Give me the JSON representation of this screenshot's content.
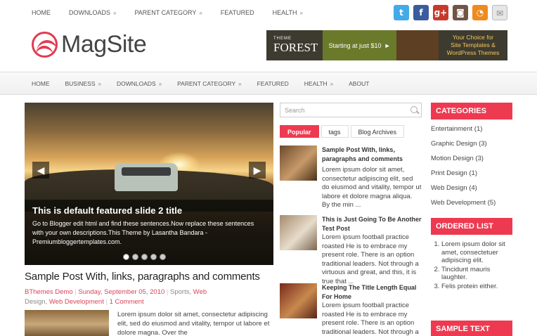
{
  "topnav": {
    "items": [
      {
        "label": "HOME",
        "caret": false
      },
      {
        "label": "DOWNLOADS",
        "caret": true
      },
      {
        "label": "PARENT CATEGORY",
        "caret": true
      },
      {
        "label": "FEATURED",
        "caret": false
      },
      {
        "label": "HEALTH",
        "caret": true
      }
    ],
    "caret_glyph": "»"
  },
  "social": [
    {
      "name": "twitter-icon",
      "glyph": "t",
      "color": "#43a9e7"
    },
    {
      "name": "facebook-icon",
      "glyph": "f",
      "color": "#3a5c9c"
    },
    {
      "name": "google-plus-icon",
      "glyph": "g+",
      "color": "#c8392c"
    },
    {
      "name": "instagram-icon",
      "glyph": "◙",
      "color": "#6f5544"
    },
    {
      "name": "rss-icon",
      "glyph": "◔",
      "color": "#f08a1d"
    },
    {
      "name": "mail-icon",
      "glyph": "✉",
      "color": "#e6e6e6"
    }
  ],
  "logo": {
    "text": "MagSite"
  },
  "banner": {
    "brand_small": "THEME",
    "brand": "FOREST",
    "offer": "Starting at just $10",
    "arrow": "►",
    "tagline_1": "Your Choice for",
    "tagline_2": "Site Templates &",
    "tagline_3": "WordPress Themes"
  },
  "mainnav": {
    "items": [
      {
        "label": "HOME",
        "caret": false
      },
      {
        "label": "BUSINESS",
        "caret": true
      },
      {
        "label": "DOWNLOADS",
        "caret": true
      },
      {
        "label": "PARENT CATEGORY",
        "caret": true
      },
      {
        "label": "FEATURED",
        "caret": false
      },
      {
        "label": "HEALTH",
        "caret": true
      },
      {
        "label": "ABOUT",
        "caret": false
      }
    ]
  },
  "slider": {
    "prev": "◀",
    "next": "▶",
    "title": "This is default featured slide 2 title",
    "text": "Go to Blogger edit html and find these sentences.Now replace these sentences with your own descriptions.This Theme by Lasantha Bandara - Premiumbloggertemplates.com.",
    "dots": 5
  },
  "post": {
    "title": "Sample Post With, links, paragraphs and comments",
    "author": "BThemes Demo",
    "date": "Sunday, September 05, 2010",
    "cat1": "Sports,",
    "cat2": "Web",
    "cat3": "Design,",
    "cat4": "Web Development",
    "comments": "1 Comment",
    "excerpt": "Lorem ipsum dolor sit amet, consectetur adipiscing elit, sed do eiusmod and vitality, tempor ut labore et dolore magna. Over the"
  },
  "search": {
    "placeholder": "Search"
  },
  "tabs": [
    "Popular",
    "tags",
    "Blog Archives"
  ],
  "popular": [
    {
      "title": "Sample Post With, links, paragraphs and comments",
      "text": "Lorem ipsum dolor sit amet, consectetur adipiscing elit, sed do eiusmod and vitality, tempor ut labore et dolore magna aliqua. By the min ..."
    },
    {
      "title": "This is Just Going To Be Another Test Post",
      "text": "Lorem ipsum football practice roasted He is to embrace my present role. There is an option traditional leaders. Not through a virtuous and great, and this, it is true that ..."
    },
    {
      "title": "Keeping The Title Length Equal For Home",
      "text": "Lorem ipsum football practice roasted He is to embrace my present role. There is an option traditional leaders. Not through a virtuous"
    }
  ],
  "sidebar": {
    "categories_title": "CATEGORIES",
    "categories": [
      "Entertainment (1)",
      "Graphic Design (3)",
      "Motion Design (3)",
      "Print Design (1)",
      "Web Design (4)",
      "Web Development (5)"
    ],
    "ordered_title": "ORDERED LIST",
    "ordered": [
      "Lorem ipsum dolor sit amet, consectetuer adipiscing elit.",
      "Tincidunt mauris laughter.",
      "Felis protein either."
    ],
    "sample_title": "SAMPLE TEXT"
  },
  "colors": {
    "accent": "#ee3a51",
    "link": "#d94458"
  }
}
